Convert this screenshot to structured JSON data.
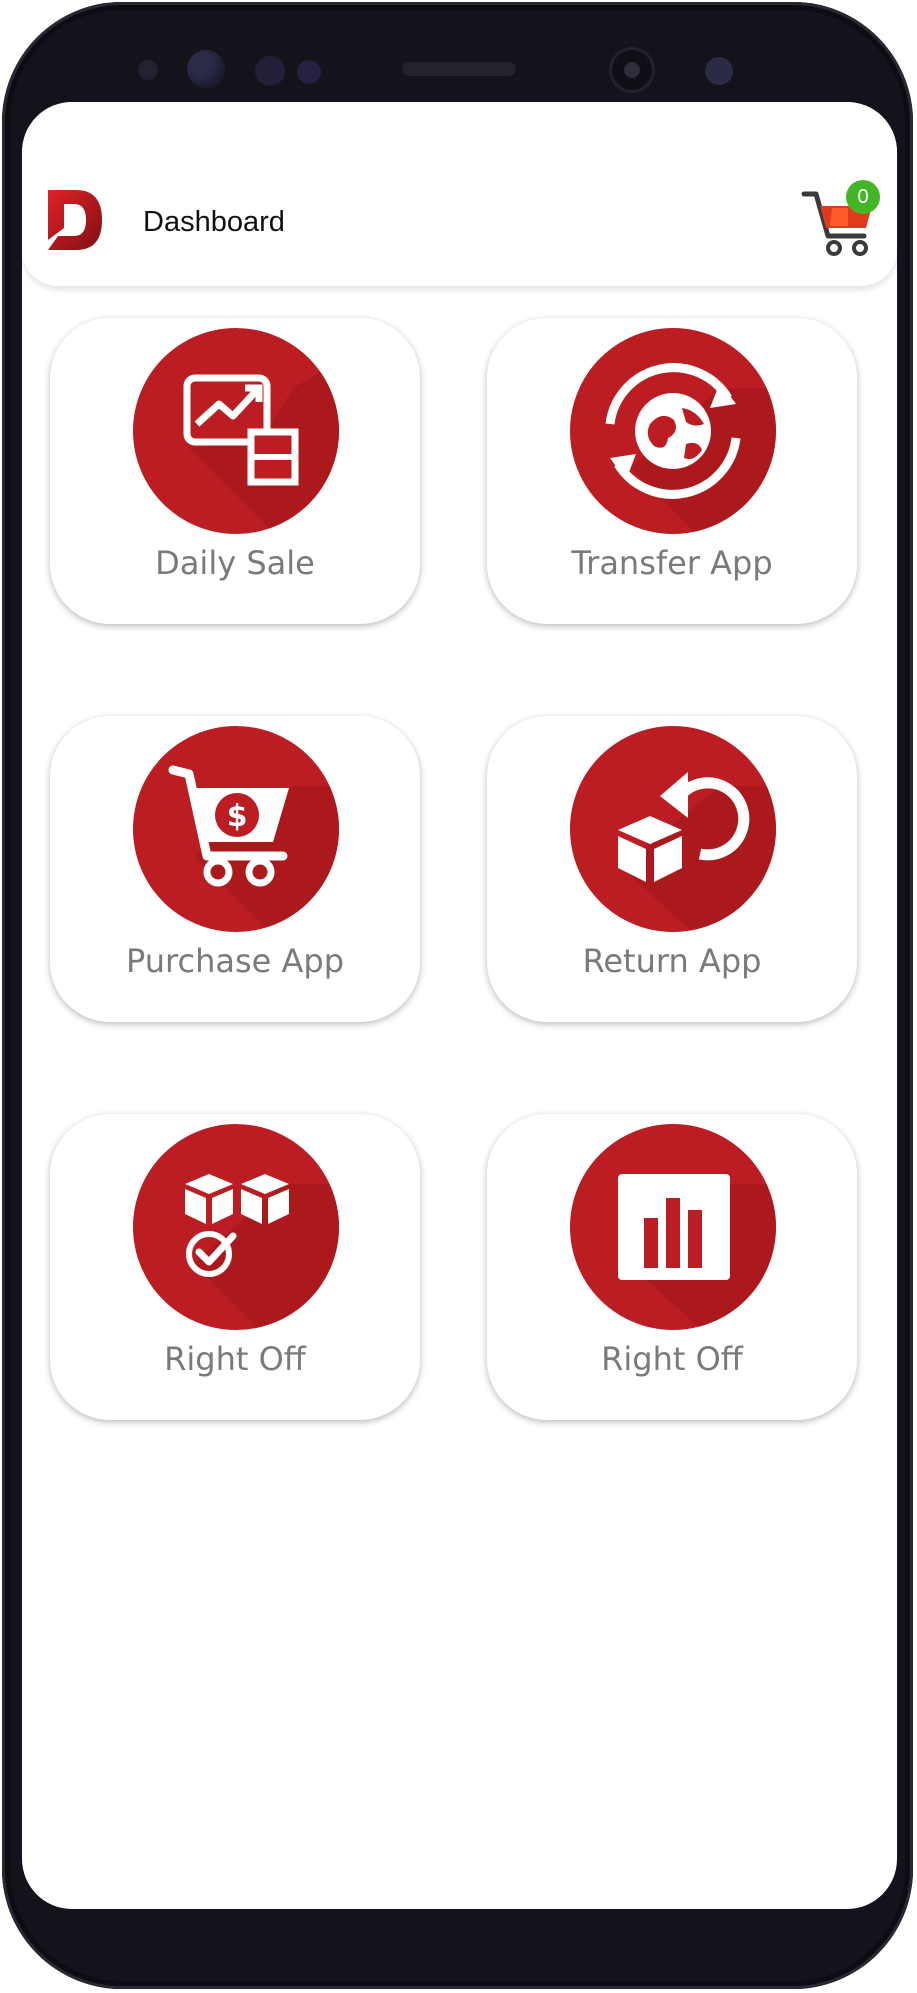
{
  "header": {
    "title": "Dashboard",
    "cart_count": "0"
  },
  "icons": {
    "logo": "logo-d-icon",
    "cart": "shopping-cart-icon"
  },
  "colors": {
    "accent": "#bb1d22",
    "badge": "#42b624"
  },
  "tiles": [
    {
      "label": "Daily Sale",
      "icon": "sales-chart-icon"
    },
    {
      "label": "Transfer App",
      "icon": "globe-transfer-icon"
    },
    {
      "label": "Purchase App",
      "icon": "cart-dollar-icon"
    },
    {
      "label": "Return App",
      "icon": "box-return-icon"
    },
    {
      "label": "Right Off",
      "icon": "boxes-check-icon"
    },
    {
      "label": "Right Off",
      "icon": "bar-chart-icon"
    }
  ]
}
